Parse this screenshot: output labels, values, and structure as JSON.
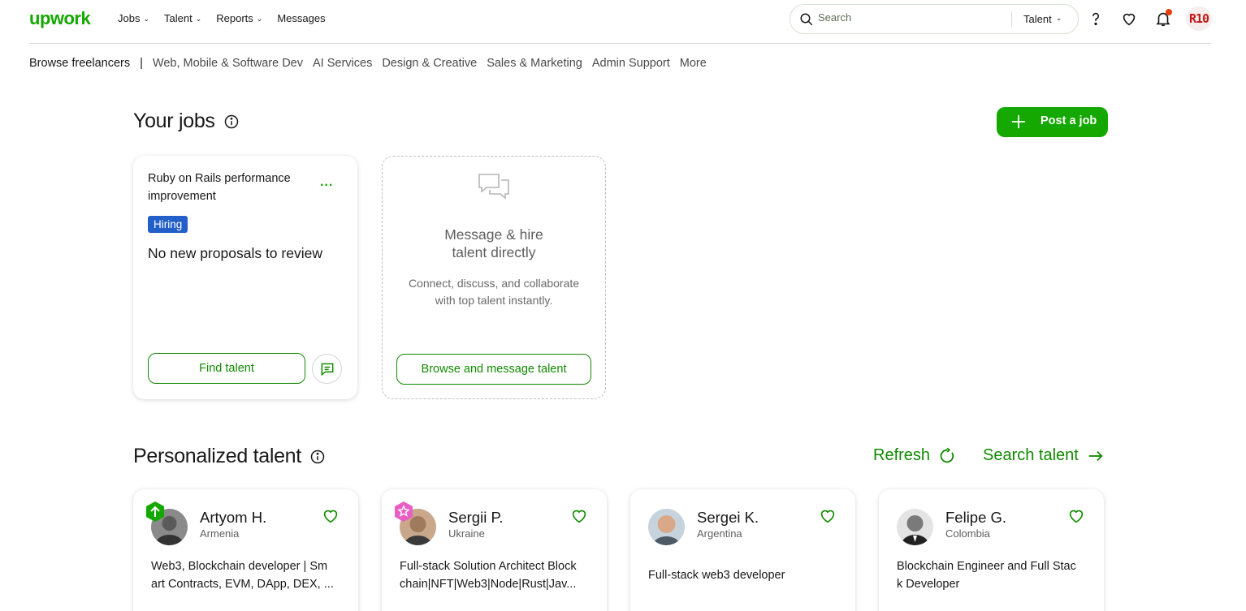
{
  "header": {
    "logo": "upwork",
    "nav": [
      {
        "label": "Jobs",
        "has_menu": true
      },
      {
        "label": "Talent",
        "has_menu": true
      },
      {
        "label": "Reports",
        "has_menu": true
      },
      {
        "label": "Messages",
        "has_menu": false
      }
    ],
    "search": {
      "placeholder": "Search",
      "scope": "Talent"
    },
    "icons": [
      "help-icon",
      "heart-icon",
      "bell-icon"
    ],
    "avatar_text": "R10"
  },
  "subnav": {
    "first": "Browse freelancers",
    "separator": "|",
    "links": [
      "Web, Mobile & Software Dev",
      "AI Services",
      "Design & Creative",
      "Sales & Marketing",
      "Admin Support",
      "More"
    ]
  },
  "jobs": {
    "title": "Your jobs",
    "post_button": "Post a job",
    "job_card": {
      "title": "Ruby on Rails performance improvement",
      "menu": "...",
      "status": "Hiring",
      "proposals": "No new proposals to review",
      "find_button": "Find talent"
    },
    "message_card": {
      "title_line1": "Message & hire",
      "title_line2": "talent directly",
      "body_line1": "Connect, discuss, and collaborate",
      "body_line2": "with top talent instantly.",
      "button": "Browse and message talent"
    }
  },
  "talent": {
    "title": "Personalized talent",
    "refresh": "Refresh",
    "search": "Search talent",
    "cards": [
      {
        "name": "Artyom H.",
        "country": "Armenia",
        "desc_line1": "Web3, Blockchain developer | Sm",
        "desc_line2": "art Contracts, EVM, DApp, DEX, ...",
        "badge": "rising-talent"
      },
      {
        "name": "Sergii P.",
        "country": "Ukraine",
        "desc_line1": "Full-stack Solution Architect Block",
        "desc_line2": "chain|NFT|Web3|Node|Rust|Jav...",
        "badge": "top-rated"
      },
      {
        "name": "Sergei K.",
        "country": "Argentina",
        "desc_line1": "Full-stack web3 developer",
        "desc_line2": "",
        "badge": ""
      },
      {
        "name": "Felipe G.",
        "country": "Colombia",
        "desc_line1": "Blockchain Engineer and Full Stac",
        "desc_line2": "k Developer",
        "badge": ""
      }
    ]
  },
  "colors": {
    "brand": "#14a800",
    "brand_dark": "#108a00",
    "hiring": "#235fc9"
  }
}
